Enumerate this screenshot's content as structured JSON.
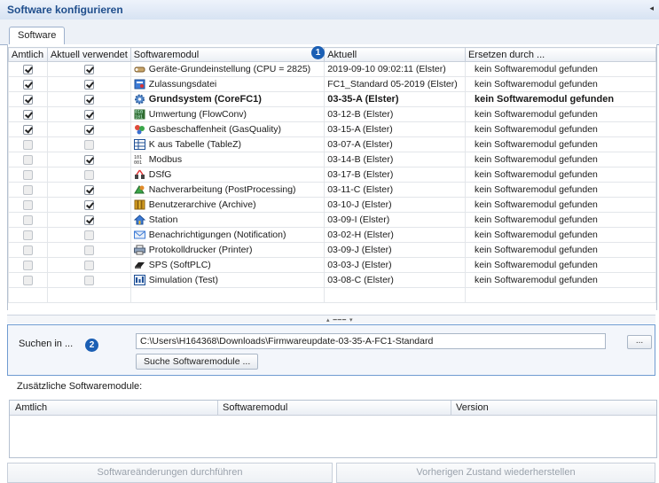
{
  "window": {
    "title": "Software konfigurieren",
    "collapse_glyph": "◂"
  },
  "tabs": [
    {
      "label": "Software"
    }
  ],
  "grid": {
    "columns": [
      "Amtlich",
      "Aktuell verwendet",
      "Softwaremodul",
      "Aktuell",
      "Ersetzen durch ..."
    ],
    "rows": [
      {
        "amtlich": true,
        "verwendet": true,
        "icon": "wrench-icon",
        "module": "Geräte-Grundeinstellung (CPU = 2825)",
        "current": "2019-09-10 09:02:11 (Elster)",
        "replace": "kein Softwaremodul gefunden"
      },
      {
        "amtlich": true,
        "verwendet": true,
        "icon": "certificate-icon",
        "module": "Zulassungsdatei",
        "current": "FC1_Standard 05-2019 (Elster)",
        "replace": "kein Softwaremodul gefunden"
      },
      {
        "amtlich": true,
        "verwendet": true,
        "icon": "gear-icon",
        "module": "Grundsystem (CoreFC1)",
        "current": "03-35-A (Elster)",
        "replace": "kein Softwaremodul gefunden",
        "bold": true
      },
      {
        "amtlich": true,
        "verwendet": true,
        "icon": "binary-icon",
        "module": "Umwertung (FlowConv)",
        "current": "03-12-B (Elster)",
        "replace": "kein Softwaremodul gefunden"
      },
      {
        "amtlich": true,
        "verwendet": true,
        "icon": "gas-quality-icon",
        "module": "Gasbeschaffenheit (GasQuality)",
        "current": "03-15-A (Elster)",
        "replace": "kein Softwaremodul gefunden"
      },
      {
        "amtlich": false,
        "verwendet": false,
        "icon": "table-icon",
        "module": "K aus Tabelle (TableZ)",
        "current": "03-07-A (Elster)",
        "replace": "kein Softwaremodul gefunden"
      },
      {
        "amtlich": false,
        "verwendet": true,
        "icon": "modbus-icon",
        "module": "Modbus",
        "current": "03-14-B (Elster)",
        "replace": "kein Softwaremodul gefunden"
      },
      {
        "amtlich": false,
        "verwendet": false,
        "icon": "dsfg-icon",
        "module": "DSfG",
        "current": "03-17-B (Elster)",
        "replace": "kein Softwaremodul gefunden"
      },
      {
        "amtlich": false,
        "verwendet": true,
        "icon": "postprocessing-icon",
        "module": "Nachverarbeitung (PostProcessing)",
        "current": "03-11-C (Elster)",
        "replace": "kein Softwaremodul gefunden"
      },
      {
        "amtlich": false,
        "verwendet": true,
        "icon": "archive-icon",
        "module": "Benutzerarchive (Archive)",
        "current": "03-10-J (Elster)",
        "replace": "kein Softwaremodul gefunden"
      },
      {
        "amtlich": false,
        "verwendet": true,
        "icon": "station-icon",
        "module": "Station",
        "current": "03-09-I (Elster)",
        "replace": "kein Softwaremodul gefunden"
      },
      {
        "amtlich": false,
        "verwendet": false,
        "icon": "notification-icon",
        "module": "Benachrichtigungen (Notification)",
        "current": "03-02-H (Elster)",
        "replace": "kein Softwaremodul gefunden"
      },
      {
        "amtlich": false,
        "verwendet": false,
        "icon": "printer-icon",
        "module": "Protokolldrucker (Printer)",
        "current": "03-09-J (Elster)",
        "replace": "kein Softwaremodul gefunden"
      },
      {
        "amtlich": false,
        "verwendet": false,
        "icon": "plc-icon",
        "module": "SPS (SoftPLC)",
        "current": "03-03-J (Elster)",
        "replace": "kein Softwaremodul gefunden"
      },
      {
        "amtlich": false,
        "verwendet": false,
        "icon": "simulation-icon",
        "module": "Simulation (Test)",
        "current": "03-08-C (Elster)",
        "replace": "kein Softwaremodul gefunden"
      }
    ]
  },
  "badges": {
    "one": "1",
    "two": "2"
  },
  "search": {
    "label": "Suchen in ...",
    "path": "C:\\Users\\H164368\\Downloads\\Firmwareupdate-03-35-A-FC1-Standard",
    "browse_label": "...",
    "search_button": "Suche Softwaremodule ..."
  },
  "additional": {
    "label": "Zusätzliche Softwaremodule:",
    "columns": [
      "Amtlich",
      "Softwaremodul",
      "Version"
    ]
  },
  "footer": {
    "apply_button": "Softwareänderungen durchführen",
    "restore_button": "Vorherigen Zustand wiederherstellen"
  },
  "colors": {
    "accent": "#1b5fb4",
    "title_text": "#1f4e8c"
  }
}
